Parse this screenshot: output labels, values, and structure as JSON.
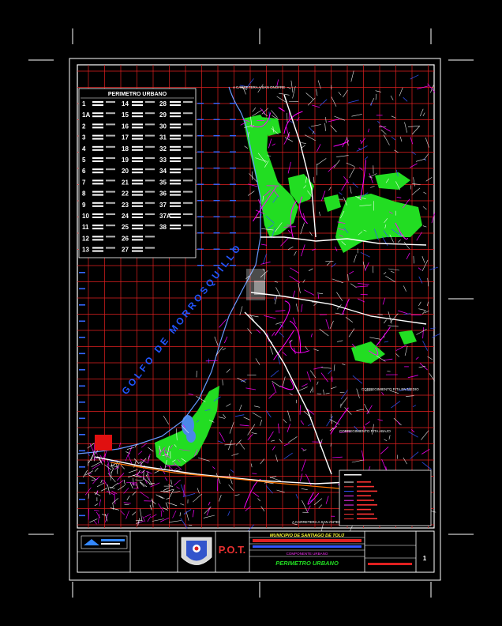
{
  "map": {
    "table_title": "PERIMETRO URBANO",
    "sea_label": "GOLFO DE MORROSQUILLO",
    "road_label_top": "A CARRETERA A SAN ONOFRE",
    "road_label_bottom": "A CARRETERA A SAN ANTERO",
    "district_label_right": "CORREGIMIENTO PITA EN MEDIO",
    "district_label_lower": "CORREGIMIENTO PITA ABAJO",
    "table_points_col1": [
      "1",
      "1A",
      "2",
      "3",
      "4",
      "5",
      "6",
      "7",
      "8",
      "9",
      "10",
      "11",
      "12",
      "13"
    ],
    "table_points_col2": [
      "14",
      "15",
      "16",
      "17",
      "18",
      "19",
      "20",
      "21",
      "22",
      "23",
      "24",
      "25",
      "26",
      "27"
    ],
    "table_points_col3": [
      "28",
      "29",
      "30",
      "31",
      "32",
      "33",
      "34",
      "35",
      "36",
      "37",
      "37A",
      "38"
    ]
  },
  "title_block": {
    "acronym": "P.O.T.",
    "municipio": "MUNICIPIO DE SANTIAGO DE TOLÚ",
    "subtitle": "COMPONENTE URBANO",
    "plan_title": "PERIMETRO URBANO",
    "sheet_number": "1"
  },
  "colors": {
    "frame": "#ffffff",
    "grid": "#e02020",
    "vegetation": "#22dd22",
    "roads": "#ffffff",
    "streets_magenta": "#ff00ff",
    "streets_blue": "#3355ff",
    "title_yellow": "#ffff33",
    "title_magenta": "#ff33ff",
    "sea_label_blue": "#2255ff"
  }
}
